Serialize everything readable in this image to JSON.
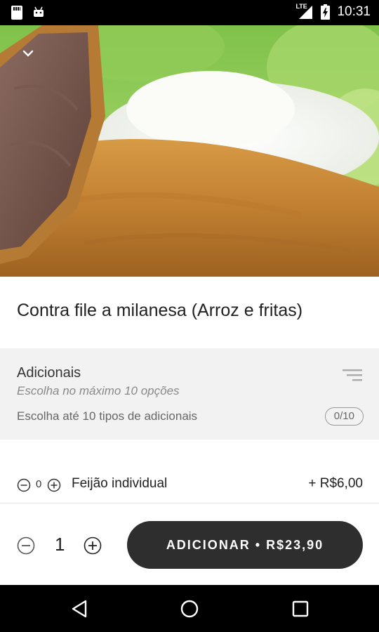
{
  "status_bar": {
    "time": "10:31",
    "network_label": "LTE",
    "icons": [
      "sd-card-icon",
      "android-icon",
      "signal-icon",
      "battery-charging-icon"
    ]
  },
  "hero": {
    "icon": "chevron-down-icon"
  },
  "product": {
    "title": "Contra file a milanesa (Arroz e fritas)"
  },
  "addons": {
    "title": "Adicionais",
    "subtitle": "Escolha no máximo 10 opções",
    "description": "Escolha até 10 tipos de adicionais",
    "counter": "0/10",
    "filter_icon": "filter-lines-icon",
    "options": [
      {
        "count": "0",
        "name": "Feijão individual",
        "price": "+ R$6,00"
      }
    ]
  },
  "order": {
    "quantity": "1",
    "add_label": "ADICIONAR • R$23,90"
  },
  "nav": {
    "icons": [
      "back-icon",
      "home-icon",
      "recent-apps-icon"
    ]
  }
}
